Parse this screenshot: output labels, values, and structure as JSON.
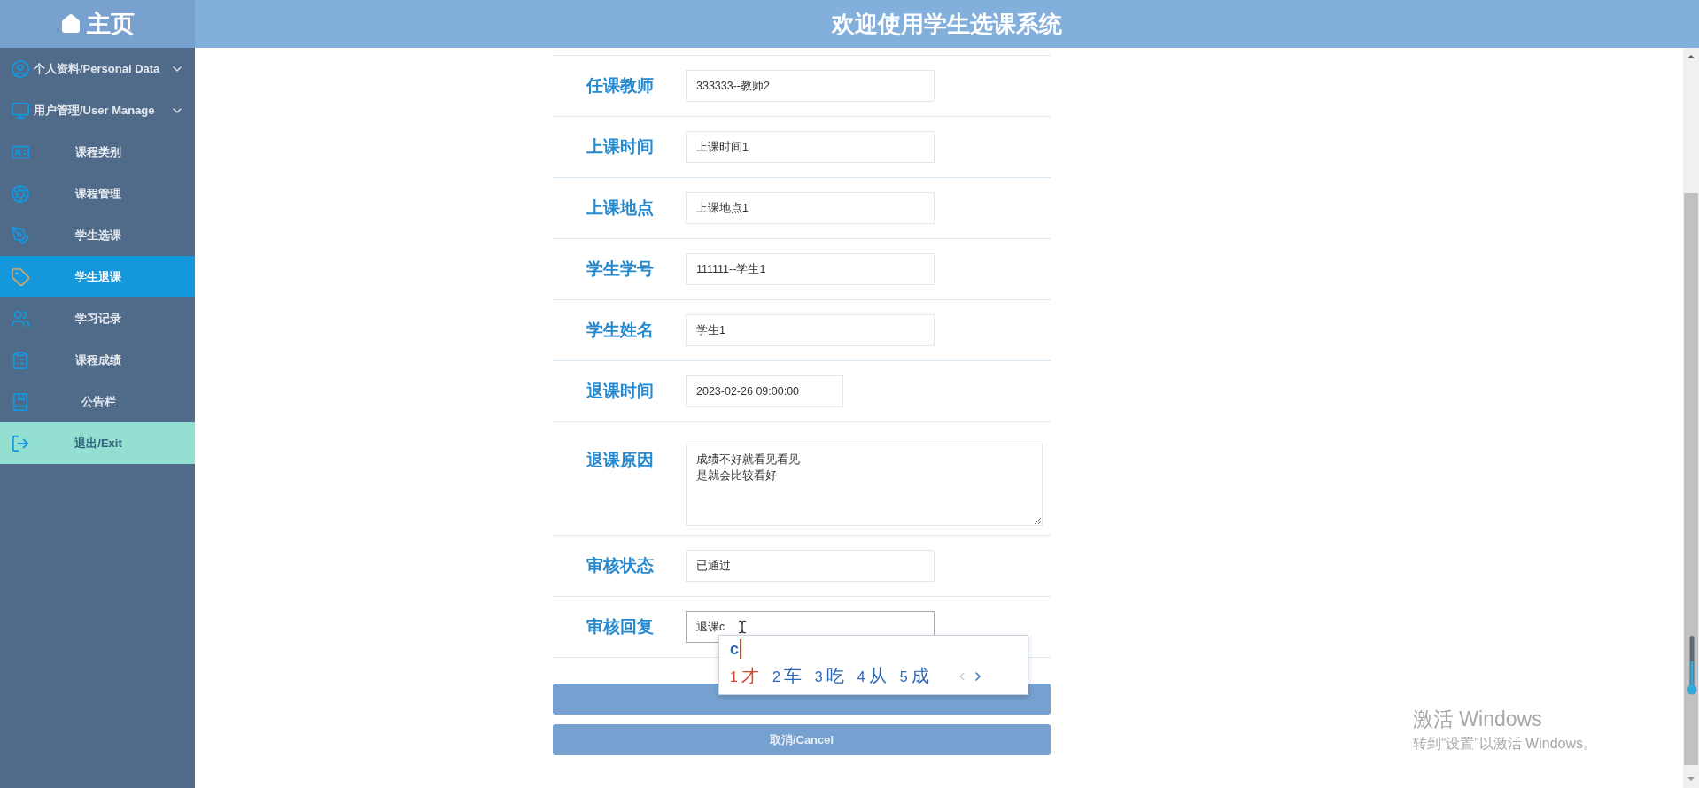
{
  "header": {
    "home_label": "主页",
    "title": "欢迎使用学生选课系统"
  },
  "sidebar": {
    "items": [
      {
        "kind": "group",
        "label": "个人资料/Personal Data",
        "selected": false
      },
      {
        "kind": "group",
        "label": "用户管理/User Manage",
        "selected": false
      },
      {
        "kind": "link",
        "label": "课程类别",
        "selected": false
      },
      {
        "kind": "link",
        "label": "课程管理",
        "selected": false
      },
      {
        "kind": "link",
        "label": "学生选课",
        "selected": false
      },
      {
        "kind": "link",
        "label": "学生退课",
        "selected": true
      },
      {
        "kind": "link",
        "label": "学习记录",
        "selected": false
      },
      {
        "kind": "link",
        "label": "课程成绩",
        "selected": false
      },
      {
        "kind": "link",
        "label": "公告栏",
        "selected": false
      },
      {
        "kind": "exit",
        "label": "退出/Exit",
        "selected": false
      }
    ]
  },
  "form": {
    "fields": [
      {
        "kind": "text",
        "label": "任课教师",
        "value": "333333--教师2",
        "focused": false
      },
      {
        "kind": "text",
        "label": "上课时间",
        "value": "上课时间1",
        "focused": false
      },
      {
        "kind": "text",
        "label": "上课地点",
        "value": "上课地点1",
        "focused": false
      },
      {
        "kind": "text",
        "label": "学生学号",
        "value": "111111--学生1",
        "focused": false
      },
      {
        "kind": "text",
        "label": "学生姓名",
        "value": "学生1",
        "focused": false
      },
      {
        "kind": "datetime",
        "label": "退课时间",
        "value": "2023-02-26 09:00:00",
        "focused": false
      },
      {
        "kind": "textarea",
        "label": "退课原因",
        "lines": [
          "成绩不好就看见看见",
          "是就会比较看好"
        ],
        "focused": false
      },
      {
        "kind": "text",
        "label": "审核状态",
        "value": "已通过",
        "focused": false
      },
      {
        "kind": "text",
        "label": "审核回复",
        "value": "退课c",
        "focused": true
      }
    ],
    "cancel_button": {
      "label": "取消/Cancel"
    }
  },
  "ime": {
    "input": "c",
    "candidates": [
      {
        "index": "1",
        "text": "才",
        "selected": true
      },
      {
        "index": "2",
        "text": "车",
        "selected": false
      },
      {
        "index": "3",
        "text": "吃",
        "selected": false
      },
      {
        "index": "4",
        "text": "从",
        "selected": false
      },
      {
        "index": "5",
        "text": "成",
        "selected": false
      }
    ],
    "prev_disabled": true
  },
  "os_notice": {
    "title": "激活 Windows",
    "message": "转到“设置”以激活 Windows。"
  }
}
